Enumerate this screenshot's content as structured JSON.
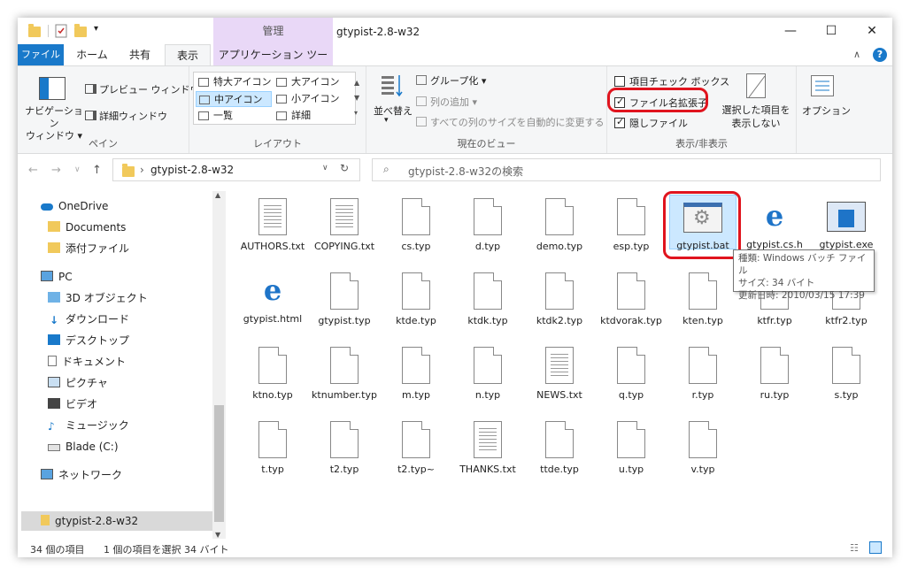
{
  "window": {
    "title": "gtypist-2.8-w32",
    "context_tab_title": "管理",
    "controls": {
      "minimize": "—",
      "maximize": "☐",
      "close": "✕"
    }
  },
  "tabs": {
    "file": "ファイル",
    "home": "ホーム",
    "share": "共有",
    "view": "表示",
    "app_tools": "アプリケーション ツール"
  },
  "ribbon": {
    "pane": {
      "nav_pane": "ナビゲーション\nウィンドウ ▾",
      "preview": "プレビュー ウィンドウ",
      "details": "詳細ウィンドウ",
      "label": "ペイン"
    },
    "layout": {
      "items": [
        "特大アイコン",
        "大アイコン",
        "中アイコン",
        "小アイコン",
        "一覧",
        "詳細"
      ],
      "selected": "中アイコン",
      "label": "レイアウト"
    },
    "current_view": {
      "sort": "並べ替え",
      "group": "グループ化 ▾",
      "add_column": "列の追加 ▾",
      "fit_columns": "すべての列のサイズを自動的に変更する",
      "label": "現在のビュー"
    },
    "show_hide": {
      "item_checkbox": "項目チェック ボックス",
      "ext": "ファイル名拡張子",
      "hidden": "隠しファイル",
      "hide_selected": "選択した項目を\n表示しない",
      "label": "表示/非表示"
    },
    "options": "オプション"
  },
  "address": {
    "path": "gtypist-2.8-w32",
    "search_placeholder": "gtypist-2.8-w32の検索"
  },
  "nav": {
    "items": [
      {
        "label": "OneDrive",
        "indent": 0
      },
      {
        "label": "Documents",
        "indent": 1
      },
      {
        "label": "添付ファイル",
        "indent": 1
      },
      {
        "label": "PC",
        "indent": 0
      },
      {
        "label": "3D オブジェクト",
        "indent": 1
      },
      {
        "label": "ダウンロード",
        "indent": 1
      },
      {
        "label": "デスクトップ",
        "indent": 1
      },
      {
        "label": "ドキュメント",
        "indent": 1
      },
      {
        "label": "ピクチャ",
        "indent": 1
      },
      {
        "label": "ビデオ",
        "indent": 1
      },
      {
        "label": "ミュージック",
        "indent": 1
      },
      {
        "label": "Blade (C:)",
        "indent": 1
      },
      {
        "label": "ネットワーク",
        "indent": 0
      },
      {
        "label": "gtypist-2.8-w32",
        "indent": 0
      }
    ]
  },
  "files": [
    {
      "name": "AUTHORS.txt",
      "icon": "text-doc-icon"
    },
    {
      "name": "COPYING.txt",
      "icon": "text-doc-icon"
    },
    {
      "name": "cs.typ",
      "icon": "blank-doc-icon"
    },
    {
      "name": "d.typ",
      "icon": "blank-doc-icon"
    },
    {
      "name": "demo.typ",
      "icon": "blank-doc-icon"
    },
    {
      "name": "esp.typ",
      "icon": "blank-doc-icon"
    },
    {
      "name": "gtypist.bat",
      "icon": "bat-icon"
    },
    {
      "name": "gtypist.cs.h",
      "icon": "ie-icon"
    },
    {
      "name": "gtypist.exe",
      "icon": "exe-icon"
    },
    {
      "name": "gtypist.html",
      "icon": "ie-icon"
    },
    {
      "name": "gtypist.typ",
      "icon": "blank-doc-icon"
    },
    {
      "name": "ktde.typ",
      "icon": "blank-doc-icon"
    },
    {
      "name": "ktdk.typ",
      "icon": "blank-doc-icon"
    },
    {
      "name": "ktdk2.typ",
      "icon": "blank-doc-icon"
    },
    {
      "name": "ktdvorak.typ",
      "icon": "blank-doc-icon"
    },
    {
      "name": "kten.typ",
      "icon": "blank-doc-icon"
    },
    {
      "name": "ktfr.typ",
      "icon": "blank-doc-icon"
    },
    {
      "name": "ktfr2.typ",
      "icon": "blank-doc-icon"
    },
    {
      "name": "ktno.typ",
      "icon": "blank-doc-icon"
    },
    {
      "name": "ktnumber.typ",
      "icon": "blank-doc-icon"
    },
    {
      "name": "m.typ",
      "icon": "blank-doc-icon"
    },
    {
      "name": "n.typ",
      "icon": "blank-doc-icon"
    },
    {
      "name": "NEWS.txt",
      "icon": "text-doc-icon"
    },
    {
      "name": "q.typ",
      "icon": "blank-doc-icon"
    },
    {
      "name": "r.typ",
      "icon": "blank-doc-icon"
    },
    {
      "name": "ru.typ",
      "icon": "blank-doc-icon"
    },
    {
      "name": "s.typ",
      "icon": "blank-doc-icon"
    },
    {
      "name": "t.typ",
      "icon": "blank-doc-icon"
    },
    {
      "name": "t2.typ",
      "icon": "blank-doc-icon"
    },
    {
      "name": "t2.typ~",
      "icon": "blank-doc-icon"
    },
    {
      "name": "THANKS.txt",
      "icon": "text-doc-icon"
    },
    {
      "name": "ttde.typ",
      "icon": "blank-doc-icon"
    },
    {
      "name": "u.typ",
      "icon": "blank-doc-icon"
    },
    {
      "name": "v.typ",
      "icon": "blank-doc-icon"
    }
  ],
  "tooltip": {
    "type": "種類: Windows バッチ ファイル",
    "size": "サイズ: 34 バイト",
    "date": "更新日時: 2010/03/15 17:39"
  },
  "status": {
    "count": "34 個の項目",
    "selected": "1 個の項目を選択  34 バイト"
  },
  "colors": {
    "accent": "#1979ca",
    "highlight": "#e0141e",
    "selection": "#cce8ff"
  }
}
